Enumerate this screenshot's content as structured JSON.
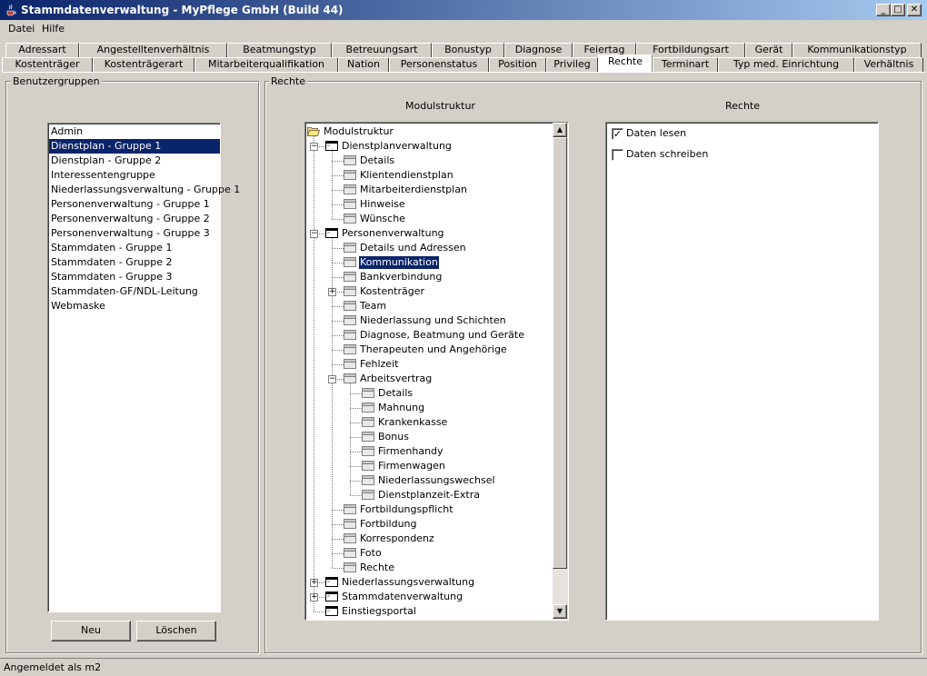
{
  "window": {
    "title": "Stammdatenverwaltung - MyPflege GmbH (Build 44)",
    "controls": {
      "minimize": "_",
      "maximize": "□",
      "close": "✕"
    }
  },
  "menu": {
    "items": [
      "Datei",
      "Hilfe"
    ]
  },
  "tabs": {
    "row1": [
      "Adressart",
      "Angestelltenverhältnis",
      "Beatmungstyp",
      "Betreuungsart",
      "Bonustyp",
      "Diagnose",
      "Feiertag",
      "Fortbildungsart",
      "Gerät",
      "Kommunikationstyp"
    ],
    "row2": [
      "Kostenträger",
      "Kostenträgerart",
      "Mitarbeiterqualifikation",
      "Nation",
      "Personenstatus",
      "Position",
      "Privileg",
      "Rechte",
      "Terminart",
      "Typ med. Einrichtung",
      "Verhältnis"
    ],
    "active": "Rechte"
  },
  "benutzergruppen": {
    "title": "Benutzergruppen",
    "items": [
      "Admin",
      "Dienstplan - Gruppe 1",
      "Dienstplan - Gruppe 2",
      "Interessentengruppe",
      "Niederlassungsverwaltung - Gruppe 1",
      "Personenverwaltung - Gruppe 1",
      "Personenverwaltung - Gruppe 2",
      "Personenverwaltung - Gruppe 3",
      "Stammdaten - Gruppe 1",
      "Stammdaten - Gruppe 2",
      "Stammdaten - Gruppe 3",
      "Stammdaten-GF/NDL-Leitung",
      "Webmaske"
    ],
    "selected": "Dienstplan - Gruppe 1",
    "new_label": "Neu",
    "delete_label": "Löschen"
  },
  "rechte": {
    "title": "Rechte",
    "tree_heading": "Modulstruktur",
    "rights_heading": "Rechte",
    "tree": [
      {
        "label": "Modulstruktur",
        "level": 0,
        "icon": "folder-open-icon"
      },
      {
        "label": "Dienstplanverwaltung",
        "level": 1,
        "icon": "module-icon",
        "toggle": "-"
      },
      {
        "label": "Details",
        "level": 2,
        "icon": "page-icon"
      },
      {
        "label": "Klientendienstplan",
        "level": 2,
        "icon": "page-icon"
      },
      {
        "label": "Mitarbeiterdienstplan",
        "level": 2,
        "icon": "page-icon"
      },
      {
        "label": "Hinweise",
        "level": 2,
        "icon": "page-icon"
      },
      {
        "label": "Wünsche",
        "level": 2,
        "icon": "page-icon"
      },
      {
        "label": "Personenverwaltung",
        "level": 1,
        "icon": "module-icon",
        "toggle": "-"
      },
      {
        "label": "Details und Adressen",
        "level": 2,
        "icon": "page-icon"
      },
      {
        "label": "Kommunikation",
        "level": 2,
        "icon": "page-icon",
        "selected": true
      },
      {
        "label": "Bankverbindung",
        "level": 2,
        "icon": "page-icon"
      },
      {
        "label": "Kostenträger",
        "level": 2,
        "icon": "page-icon",
        "toggle": "+"
      },
      {
        "label": "Team",
        "level": 2,
        "icon": "page-icon"
      },
      {
        "label": "Niederlassung und Schichten",
        "level": 2,
        "icon": "page-icon"
      },
      {
        "label": "Diagnose, Beatmung und Geräte",
        "level": 2,
        "icon": "page-icon"
      },
      {
        "label": "Therapeuten und Angehörige",
        "level": 2,
        "icon": "page-icon"
      },
      {
        "label": "Fehlzeit",
        "level": 2,
        "icon": "page-icon"
      },
      {
        "label": "Arbeitsvertrag",
        "level": 2,
        "icon": "page-icon",
        "toggle": "-"
      },
      {
        "label": "Details",
        "level": 3,
        "icon": "page-icon"
      },
      {
        "label": "Mahnung",
        "level": 3,
        "icon": "page-icon"
      },
      {
        "label": "Krankenkasse",
        "level": 3,
        "icon": "page-icon"
      },
      {
        "label": "Bonus",
        "level": 3,
        "icon": "page-icon"
      },
      {
        "label": "Firmenhandy",
        "level": 3,
        "icon": "page-icon"
      },
      {
        "label": "Firmenwagen",
        "level": 3,
        "icon": "page-icon"
      },
      {
        "label": "Niederlassungswechsel",
        "level": 3,
        "icon": "page-icon"
      },
      {
        "label": "Dienstplanzeit-Extra",
        "level": 3,
        "icon": "page-icon"
      },
      {
        "label": "Fortbildungspflicht",
        "level": 2,
        "icon": "page-icon"
      },
      {
        "label": "Fortbildung",
        "level": 2,
        "icon": "page-icon"
      },
      {
        "label": "Korrespondenz",
        "level": 2,
        "icon": "page-icon"
      },
      {
        "label": "Foto",
        "level": 2,
        "icon": "page-icon"
      },
      {
        "label": "Rechte",
        "level": 2,
        "icon": "page-icon"
      },
      {
        "label": "Niederlassungsverwaltung",
        "level": 1,
        "icon": "module-icon",
        "toggle": "+"
      },
      {
        "label": "Stammdatenverwaltung",
        "level": 1,
        "icon": "module-icon",
        "toggle": "+"
      },
      {
        "label": "Einstiegsportal",
        "level": 1,
        "icon": "module-icon"
      }
    ],
    "checkboxes": [
      {
        "label": "Daten lesen",
        "checked": true
      },
      {
        "label": "Daten schreiben",
        "checked": false
      }
    ],
    "check_mark": "✓"
  },
  "scrollbar": {
    "up": "▲",
    "down": "▼"
  },
  "tree_toggles": {
    "-": "−",
    "+": "+"
  },
  "status": "Angemeldet als m2"
}
